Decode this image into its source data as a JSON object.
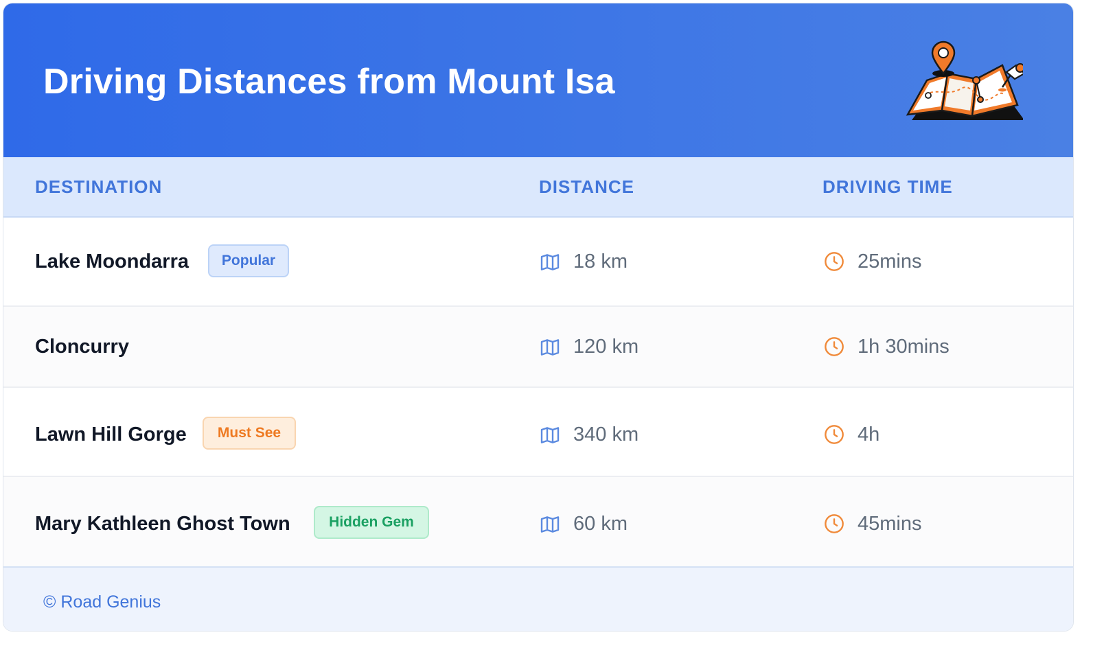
{
  "header": {
    "title": "Driving Distances from Mount Isa",
    "illustration_icon": "map-pin-illustration"
  },
  "columns": {
    "destination": "DESTINATION",
    "distance": "DISTANCE",
    "driving_time": "DRIVING TIME"
  },
  "rows": [
    {
      "destination": "Lake Moondarra",
      "badge": "Popular",
      "badge_color": "#4175da",
      "distance": "18 km",
      "time": "25mins"
    },
    {
      "destination": "Cloncurry",
      "badge": "",
      "distance": "120 km",
      "time": "1h 30mins"
    },
    {
      "destination": "Lawn Hill Gorge",
      "badge": "Must See",
      "badge_color": "#ee7a22",
      "distance": "340 km",
      "time": "4h"
    },
    {
      "destination": "Mary Kathleen Ghost Town",
      "badge": "Hidden Gem",
      "badge_color": "#1aa062",
      "distance": "60 km",
      "time": "45mins"
    }
  ],
  "icons": {
    "distance": "map-icon",
    "time": "clock-icon"
  },
  "colors": {
    "header_start": "#2f6ae8",
    "header_end": "#4a80e4",
    "accent": "#4175da",
    "clock": "#f08a3a"
  },
  "footer": {
    "credit": "© Road Genius"
  }
}
